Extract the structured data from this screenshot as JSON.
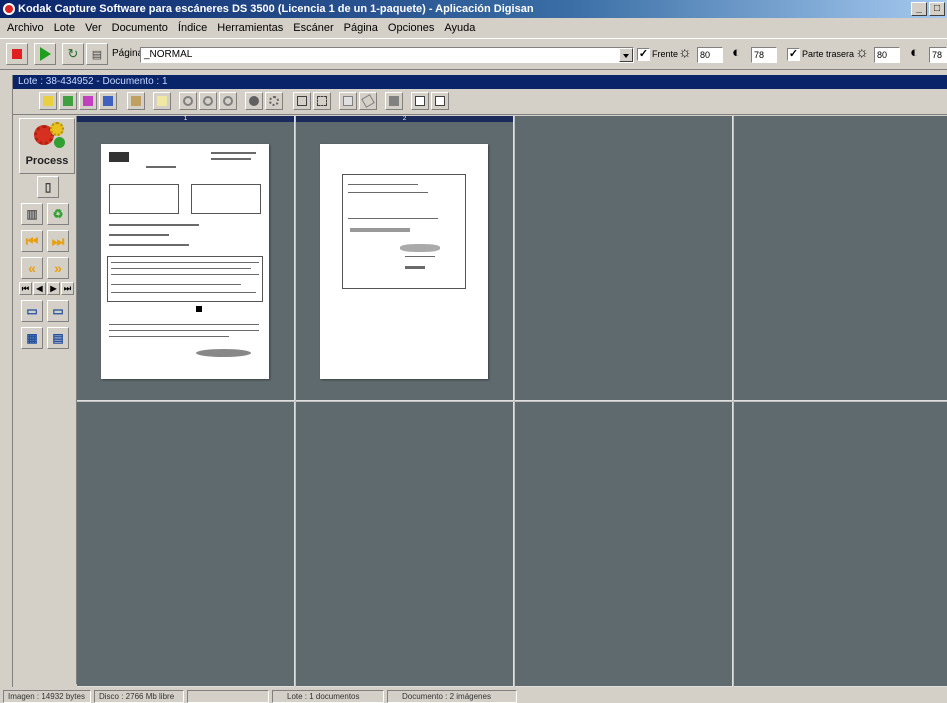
{
  "window": {
    "title": "Kodak Capture Software para escáneres  DS 3500  (Licencia 1 de un 1-paquete) - Aplicación Digisan",
    "controls": [
      "_",
      "□"
    ]
  },
  "menu": [
    "Archivo",
    "Lote",
    "Ver",
    "Documento",
    "Índice",
    "Herramientas",
    "Escáner",
    "Página",
    "Opciones",
    "Ayuda"
  ],
  "toolbar": {
    "page_label": "Página",
    "page_value": "_NORMAL",
    "front_label": "Frente",
    "front_brightness": "80",
    "front_contrast": "78",
    "back_label": "Parte trasera",
    "back_brightness": "80",
    "back_contrast": "78",
    "checkmark": "✓",
    "brightness_symbol": "☼",
    "contrast_symbol": "◐"
  },
  "document_window": {
    "title": "Lote : 38-434952 - Documento : 1"
  },
  "left_panel": {
    "process_label": "Process"
  },
  "viewer": {
    "page_headers": [
      "1",
      "2"
    ]
  },
  "statusbar": {
    "image": "Imagen : 14932 bytes",
    "disk": "Disco : 2766 Mb libre",
    "batch": "Lote : 1 documentos",
    "document": "Documento : 2 imágenes"
  },
  "colors": {
    "title_bar": "#0a246a",
    "viewer_background": "#5f6a6e",
    "stop": "#e02020",
    "play": "#1ea01e"
  }
}
